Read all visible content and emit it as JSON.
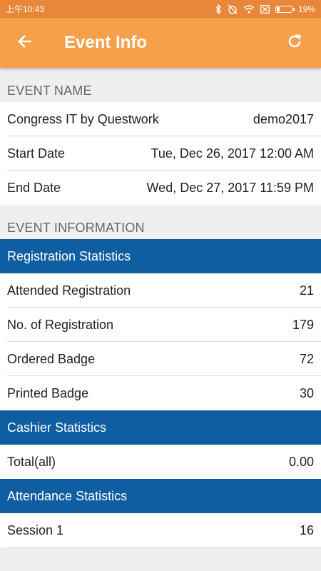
{
  "status_bar": {
    "time": "上午10:43",
    "battery_percent": "19%",
    "battery_level": 0.19
  },
  "app_bar": {
    "title": "Event Info",
    "back_icon": "arrow-left-icon",
    "refresh_icon": "refresh-icon"
  },
  "event_name_section": {
    "header": "EVENT NAME",
    "rows": [
      {
        "label": "Congress IT by Questwork",
        "value": "demo2017"
      },
      {
        "label": "Start Date",
        "value": "Tue, Dec 26, 2017 12:00 AM"
      },
      {
        "label": "End Date",
        "value": "Wed, Dec 27, 2017 11:59 PM"
      }
    ]
  },
  "event_information_section": {
    "header": "EVENT INFORMATION",
    "registration": {
      "header": "Registration Statistics",
      "rows": [
        {
          "label": "Attended Registration",
          "value": "21"
        },
        {
          "label": "No. of Registration",
          "value": "179"
        },
        {
          "label": "Ordered Badge",
          "value": "72"
        },
        {
          "label": "Printed Badge",
          "value": "30"
        }
      ]
    },
    "cashier": {
      "header": "Cashier Statistics",
      "rows": [
        {
          "label": "Total(all)",
          "value": "0.00"
        }
      ]
    },
    "attendance": {
      "header": "Attendance Statistics",
      "rows": [
        {
          "label": "Session 1",
          "value": "16"
        }
      ]
    }
  },
  "colors": {
    "status_bar": "#e8873a",
    "app_bar": "#f7a04b",
    "group_header": "#0f5ea2",
    "background": "#efefef"
  }
}
